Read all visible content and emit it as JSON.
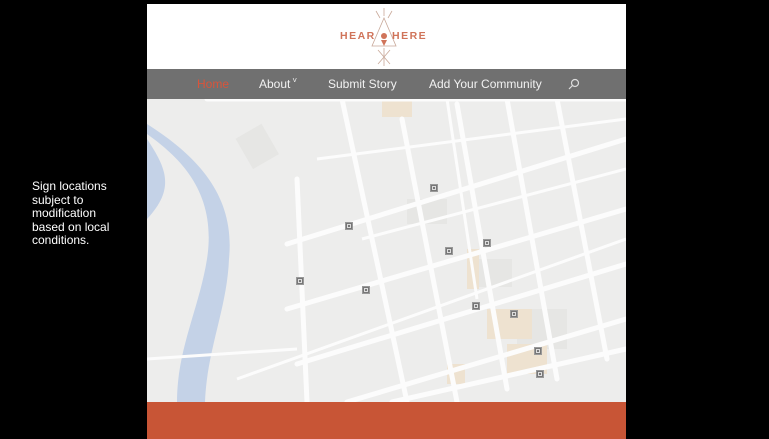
{
  "side_note": "Sign locations subject to modification based on local conditions.",
  "logo": {
    "left_word": "HEAR",
    "right_word": "HERE"
  },
  "nav": {
    "items": [
      {
        "label": "Home",
        "active": true
      },
      {
        "label": "About",
        "has_dropdown": true
      },
      {
        "label": "Submit Story"
      },
      {
        "label": "Add Your Community"
      }
    ],
    "search_icon": "search-icon"
  },
  "colors": {
    "accent": "#d9543b",
    "nav_bg": "#707070",
    "footer": "#c85536",
    "river": "#b4c7e3"
  }
}
